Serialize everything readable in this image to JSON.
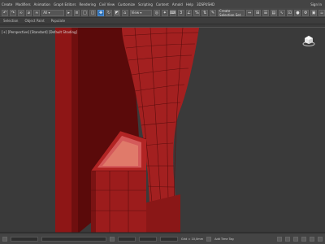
{
  "menu": {
    "items": [
      "Create",
      "Modifiers",
      "Animation",
      "Graph Editors",
      "Rendering",
      "Civil View",
      "Customize",
      "Scripting",
      "Content",
      "Arnold",
      "Help",
      "3DSPUSHD"
    ],
    "signin": "Sign In"
  },
  "toolbar": {
    "selection_set": "Create Selection Set"
  },
  "ribbon": {
    "tabs": [
      "Selection",
      "Object Paint",
      "Populate"
    ]
  },
  "viewport": {
    "label": "[+] [Perspective] [Standard] [Default Shading]",
    "object_color": "#9b1c1c"
  },
  "statusbar": {
    "grid": "Grid = 10,0mm",
    "add_time_tag": "Add Time Tag"
  },
  "colors": {
    "selected_tool": "#2f6fb2",
    "background": "#3a3a3a"
  }
}
